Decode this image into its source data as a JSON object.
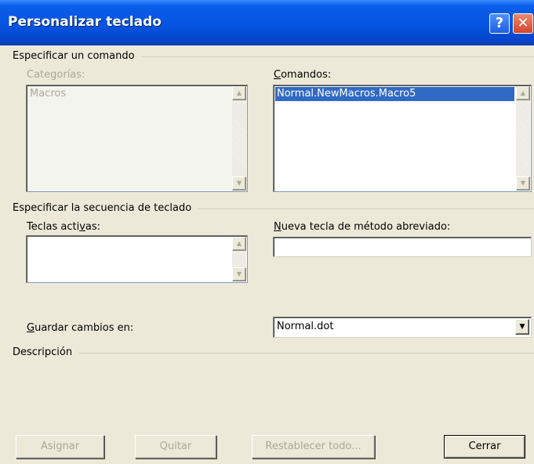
{
  "window": {
    "title": "Personalizar teclado",
    "help_glyph": "?",
    "close_glyph": "✕"
  },
  "groups": {
    "command": "Especificar un comando",
    "keyboard": "Especificar la secuencia de teclado",
    "description": "Descripción"
  },
  "categories": {
    "label_pre": "Categorías:",
    "items": [
      "Macros"
    ],
    "enabled": false
  },
  "commands": {
    "label_pre": "",
    "label_key": "C",
    "label_post": "omandos:",
    "items": [
      "Normal.NewMacros.Macro5"
    ],
    "selected": "Normal.NewMacros.Macro5"
  },
  "current_keys": {
    "label_pre": "Teclas acti",
    "label_key": "v",
    "label_post": "as:",
    "items": []
  },
  "new_shortcut": {
    "label_pre": "",
    "label_key": "N",
    "label_post": "ueva tecla de método abreviado:",
    "value": ""
  },
  "save_in": {
    "label_pre": "",
    "label_key": "G",
    "label_post": "uardar cambios en:",
    "value": "Normal.dot"
  },
  "buttons": {
    "assign": "Asignar",
    "remove": "Quitar",
    "reset_all": "Restablecer todo...",
    "close": "Cerrar"
  },
  "icons": {
    "scroll_up": "▲",
    "scroll_down": "▼",
    "dropdown": "▼"
  },
  "colors": {
    "titlebar": "#0654e2",
    "selection": "#316ac5",
    "dialog_bg": "#ece9d8",
    "disabled_text": "#aca899"
  }
}
